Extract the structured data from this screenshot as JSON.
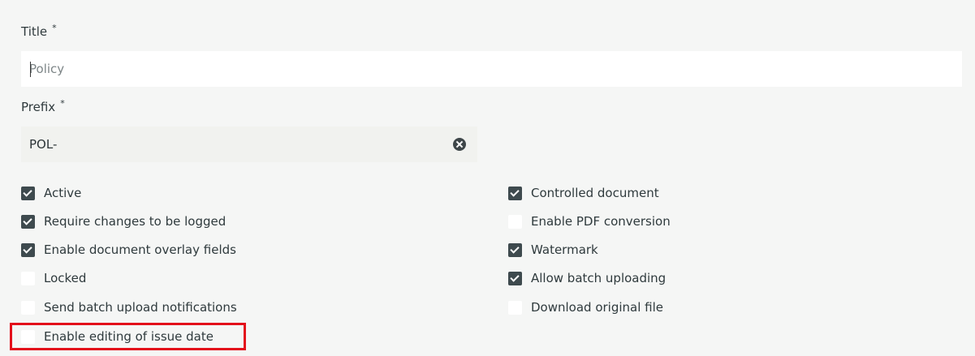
{
  "form": {
    "title_label": "Title",
    "title_required": "*",
    "title_value": "",
    "title_placeholder": "Policy",
    "prefix_label": "Prefix",
    "prefix_required": "*",
    "prefix_value": "POL-"
  },
  "options_left": [
    {
      "label": "Active",
      "checked": true
    },
    {
      "label": "Require changes to be logged",
      "checked": true
    },
    {
      "label": "Enable document overlay fields",
      "checked": true
    },
    {
      "label": "Locked",
      "checked": false
    },
    {
      "label": "Send batch upload notifications",
      "checked": false
    },
    {
      "label": "Enable editing of issue date",
      "checked": false
    }
  ],
  "options_right": [
    {
      "label": "Controlled document",
      "checked": true
    },
    {
      "label": "Enable PDF conversion",
      "checked": false
    },
    {
      "label": "Watermark",
      "checked": true
    },
    {
      "label": "Allow batch uploading",
      "checked": true
    },
    {
      "label": "Download original file",
      "checked": false
    }
  ],
  "icons": {
    "clear": "times-circle-icon",
    "check": "checkmark-icon"
  },
  "colors": {
    "highlight": "#e3101b",
    "checkbox_checked": "#3e4a4e",
    "background": "#f5f6f5"
  }
}
